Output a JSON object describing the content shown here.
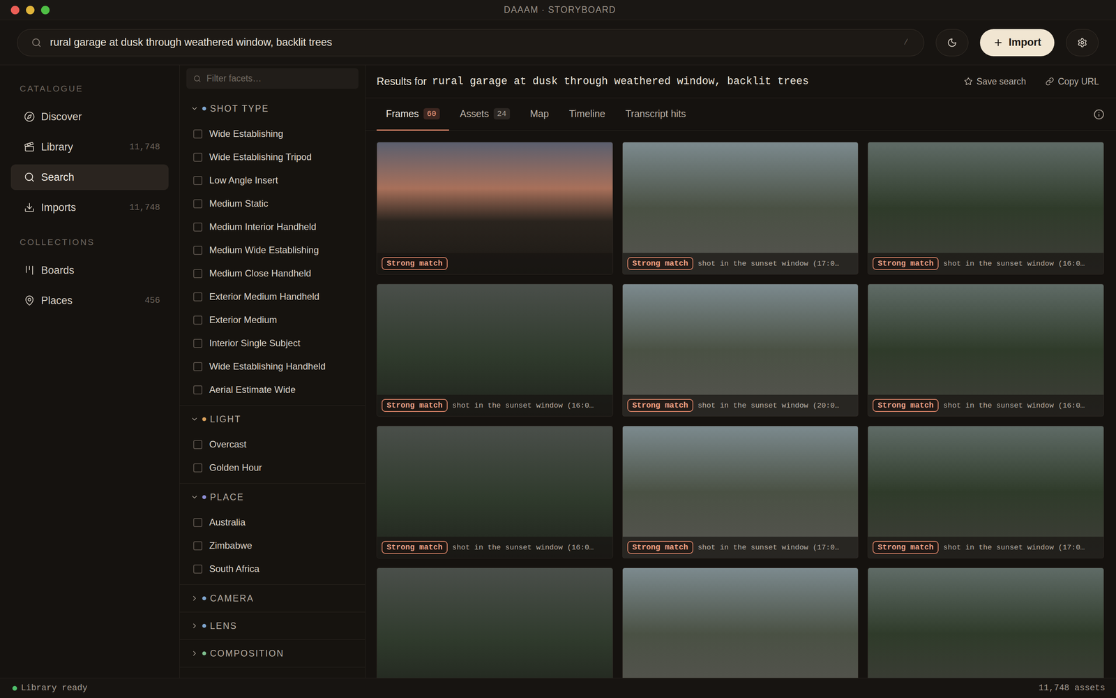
{
  "window": {
    "title": "DAAAM · STORYBOARD"
  },
  "search": {
    "query": "rural garage at dusk through weathered window, backlit trees",
    "shortcut": "/"
  },
  "toolbar": {
    "import_label": "Import"
  },
  "sidebar": {
    "sections": [
      {
        "label": "CATALOGUE",
        "items": [
          {
            "label": "Discover",
            "selected": false
          },
          {
            "label": "Library",
            "count": "11,748",
            "selected": false
          },
          {
            "label": "Search",
            "selected": true
          },
          {
            "label": "Imports",
            "count": "11,748",
            "selected": false
          }
        ]
      },
      {
        "label": "COLLECTIONS",
        "items": [
          {
            "label": "Boards",
            "selected": false
          },
          {
            "label": "Places",
            "count": "456",
            "selected": false
          }
        ]
      }
    ]
  },
  "facets": {
    "filter_placeholder": "Filter facets…",
    "groups": [
      {
        "label": "SHOT TYPE",
        "color": "#7fa6cf",
        "expanded": true,
        "options": [
          {
            "label": "Wide Establishing",
            "checked": false
          },
          {
            "label": "Wide Establishing Tripod",
            "checked": false
          },
          {
            "label": "Low Angle Insert",
            "checked": false
          },
          {
            "label": "Medium Static",
            "checked": false
          },
          {
            "label": "Medium Interior Handheld",
            "checked": false
          },
          {
            "label": "Medium Wide Establishing",
            "checked": false
          },
          {
            "label": "Medium Close Handheld",
            "checked": false
          },
          {
            "label": "Exterior Medium Handheld",
            "checked": false
          },
          {
            "label": "Exterior Medium",
            "checked": false
          },
          {
            "label": "Interior Single Subject",
            "checked": false
          },
          {
            "label": "Wide Establishing Handheld",
            "checked": false
          },
          {
            "label": "Aerial Estimate Wide",
            "checked": false
          }
        ]
      },
      {
        "label": "LIGHT",
        "color": "#d9a05b",
        "expanded": true,
        "options": [
          {
            "label": "Overcast",
            "checked": false
          },
          {
            "label": "Golden Hour",
            "checked": false
          }
        ]
      },
      {
        "label": "PLACE",
        "color": "#8e8fd6",
        "expanded": true,
        "options": [
          {
            "label": "Australia",
            "checked": false
          },
          {
            "label": "Zimbabwe",
            "checked": false
          },
          {
            "label": "South Africa",
            "checked": false
          }
        ]
      },
      {
        "label": "CAMERA",
        "color": "#7fa6cf",
        "expanded": false,
        "options": []
      },
      {
        "label": "LENS",
        "color": "#7fa6cf",
        "expanded": false,
        "options": []
      },
      {
        "label": "COMPOSITION",
        "color": "#7fbf8f",
        "expanded": false,
        "options": []
      }
    ]
  },
  "results": {
    "prefix": "Results for",
    "query": "rural garage at dusk through weathered window, backlit trees",
    "save_label": "Save search",
    "copy_label": "Copy URL"
  },
  "tabs": [
    {
      "label": "Frames",
      "count": "60",
      "selected": true
    },
    {
      "label": "Assets",
      "count": "24",
      "selected": false
    },
    {
      "label": "Map",
      "selected": false
    },
    {
      "label": "Timeline",
      "selected": false
    },
    {
      "label": "Transcript hits",
      "selected": false
    }
  ],
  "frames": [
    {
      "badge": "Strong match"
    },
    {
      "badge": "Strong match",
      "caption": "shot in the sunset window (17:0…"
    },
    {
      "badge": "Strong match",
      "caption": "shot in the sunset window (16:0…"
    },
    {
      "badge": "Strong match",
      "caption": "shot in the sunset window (16:0…"
    },
    {
      "badge": "Strong match",
      "caption": "shot in the sunset window (20:0…"
    },
    {
      "badge": "Strong match",
      "caption": "shot in the sunset window (16:0…"
    },
    {
      "badge": "Strong match",
      "caption": "shot in the sunset window (16:0…"
    },
    {
      "badge": "Strong match",
      "caption": "shot in the sunset window (17:0…"
    },
    {
      "badge": "Strong match",
      "caption": "shot in the sunset window (17:0…"
    },
    {},
    {},
    {}
  ],
  "status_bar": {
    "left": "Library ready",
    "right": "11,748 assets"
  }
}
